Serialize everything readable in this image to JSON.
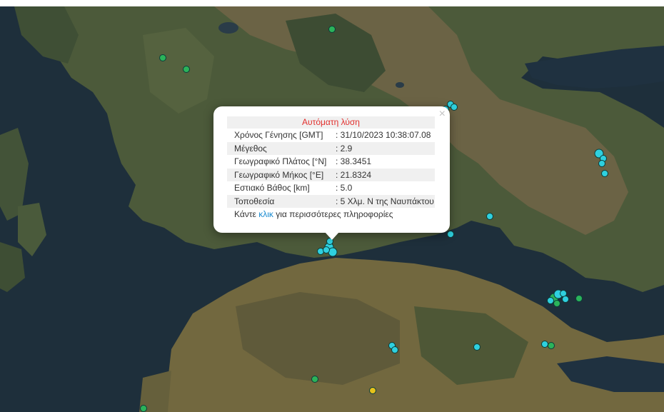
{
  "popup": {
    "title": "Αυτόματη λύση",
    "close_label": "×",
    "rows": [
      {
        "label": "Χρόνος Γένησης [GMT]",
        "value": ": 31/10/2023 10:38:07.08"
      },
      {
        "label": "Μέγεθος",
        "value": ": 2.9"
      },
      {
        "label": "Γεωγραφικό Πλάτος [°N]",
        "value": ": 38.3451"
      },
      {
        "label": "Γεωγραφικό Μήκος [°E]",
        "value": ": 21.8324"
      },
      {
        "label": "Εστιακό Βάθος [km]",
        "value": ": 5.0"
      },
      {
        "label": "Τοποθεσία",
        "value": ": 5 Χλμ. Ν της Ναυπάκτου"
      }
    ],
    "more_prefix": "Κάντε ",
    "more_link": "κλικ",
    "more_suffix": " για περισσότερες πληροφορίες"
  },
  "colors": {
    "marker_cyan": "#2fd0df",
    "marker_green": "#2bb35a",
    "marker_yellow": "#e6c21a",
    "title_red": "#e2302e",
    "link_blue": "#1a8bd0"
  }
}
